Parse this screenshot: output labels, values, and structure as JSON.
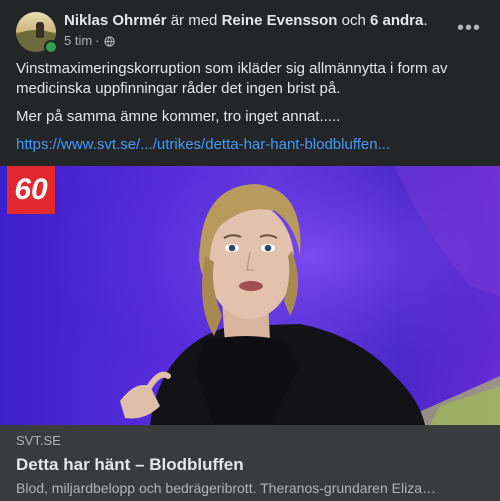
{
  "post": {
    "author": "Niklas Ohrmér",
    "with_text": "är med",
    "tagged": "Reine Evensson",
    "and_text": "och",
    "others": "6 andra",
    "period": ".",
    "time": "5 tim",
    "separator": "·",
    "privacy_icon": "globe-icon",
    "more_icon": "more-options-icon",
    "more_label": "•••",
    "status_color": "#31a24c"
  },
  "text": {
    "paragraph1": "Vinstmaximeringskorruption som ikläder sig allmännytta i form av medicinska uppfinningar råder det ingen brist på.",
    "paragraph2": "Mer på samma ämne kommer, tro inget annat.....",
    "link": "https://www.svt.se/.../utrikes/detta-har-hant-blodbluffen..."
  },
  "media": {
    "badge": "60",
    "badge_color": "#e3282f"
  },
  "link_card": {
    "source": "SVT.SE",
    "title": "Detta har hänt – Blodbluffen",
    "description": "Blod, miljardbelopp och bedrägeribrott. Theranos-grundaren Eliza…"
  }
}
